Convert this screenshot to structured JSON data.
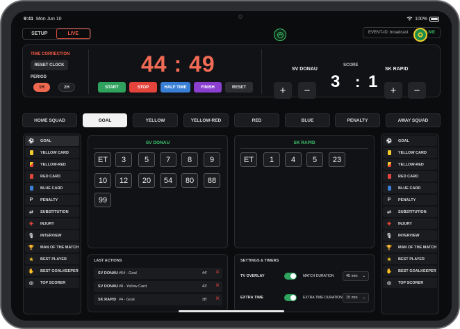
{
  "status": {
    "time": "9:41",
    "date": "Mon Jun 10",
    "battery": "100%"
  },
  "mode_tabs": {
    "setup": "SETUP",
    "live": "LIVE"
  },
  "event": {
    "id": "EVENT-ID: broadcast",
    "status": "LIVE"
  },
  "time_correction": {
    "label": "TIME CORRECTION",
    "reset_clock": "RESET CLOCK",
    "period_label": "PERIOD",
    "periods": [
      "1H",
      "2H"
    ],
    "selected_period": "1H"
  },
  "clock": {
    "display": "44 : 49",
    "controls": [
      "START",
      "STOP",
      "HALF TIME",
      "FINISH",
      "RESET"
    ]
  },
  "match": {
    "home": {
      "name": "SV DONAU",
      "score": "3"
    },
    "away": {
      "name": "SK RAPID",
      "score": "1"
    },
    "score_label": "SCORE",
    "separator": ":",
    "plus": "+",
    "minus": "−"
  },
  "tabs": {
    "home_squad": "HOME SQUAD",
    "away_squad": "AWAY SQUAD",
    "events": [
      "GOAL",
      "YELLOW",
      "YELLOW-RED",
      "RED",
      "BLUE",
      "PENALTY"
    ],
    "active": "GOAL"
  },
  "event_types": [
    "GOAL",
    "YELLOW CARD",
    "YELLOW-RED",
    "RED CARD",
    "BLUE CARD",
    "PENALTY",
    "SUBSTITUTION",
    "INJURY",
    "INTERVIEW",
    "MAN OF THE MATCH",
    "BEST PLAYER",
    "BEST GOALKEEPER",
    "TOP SCORER"
  ],
  "home_numbers": {
    "title": "SV DONAU",
    "numbers": [
      "ET",
      "3",
      "5",
      "7",
      "8",
      "9",
      "10",
      "12",
      "20",
      "54",
      "80",
      "88",
      "99"
    ]
  },
  "away_numbers": {
    "title": "SK RAPID",
    "numbers": [
      "ET",
      "1",
      "4",
      "5",
      "23"
    ]
  },
  "last_actions": {
    "title": "LAST ACTIONS",
    "items": [
      {
        "team": "SV DONAU",
        "desc": "#54 - Goal",
        "minute": "44'"
      },
      {
        "team": "SV DONAU",
        "desc": "#8 - Yellow Card",
        "minute": "43'"
      },
      {
        "team": "SK RAPID",
        "desc": "#4 - Goal",
        "minute": "38'"
      }
    ]
  },
  "settings": {
    "title": "SETTINGS & TIMERS",
    "tv_overlay": "TV OVERLAY",
    "extra_time": "EXTRA TIME",
    "match_duration_label": "MATCH DURATION",
    "match_duration": "45 min",
    "extra_time_duration_label": "EXTRA TIME DURATION",
    "extra_time_duration": "15 min",
    "tv_overlay_on": true,
    "extra_time_on": true
  },
  "colors": {
    "accent": "#f05a45",
    "green": "#3cc46a",
    "start": "#2fa35d",
    "stop": "#e4443c",
    "half_time": "#3a7fd6",
    "finish": "#8a3fcf"
  }
}
